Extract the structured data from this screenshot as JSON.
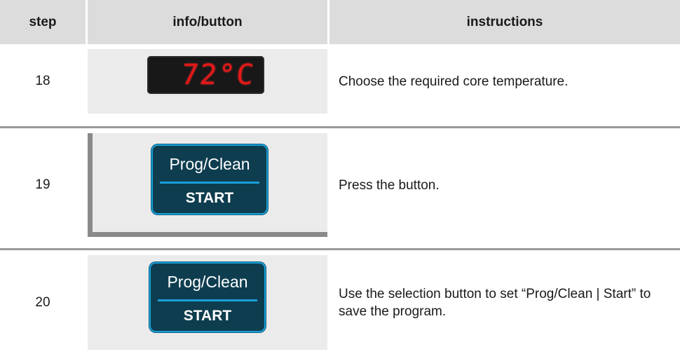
{
  "header": {
    "step": "step",
    "info": "info/button",
    "instructions": "instructions"
  },
  "rows": [
    {
      "step": "18",
      "display": "72°C",
      "instruction": "Choose the required core temperature."
    },
    {
      "step": "19",
      "button_top": "Prog/Clean",
      "button_bottom": "START",
      "instruction": "Press the button."
    },
    {
      "step": "20",
      "button_top": "Prog/Clean",
      "button_bottom": "START",
      "instruction": "Use the selection button to set “Prog/Clean | Start” to save the program."
    }
  ],
  "colors": {
    "header_bg": "#dcdcdc",
    "cell_bg": "#ebebeb",
    "divider": "#9a9a9a",
    "led_red": "#e01818",
    "button_bg": "#0e3d4f",
    "button_accent": "#1aa0d8"
  }
}
